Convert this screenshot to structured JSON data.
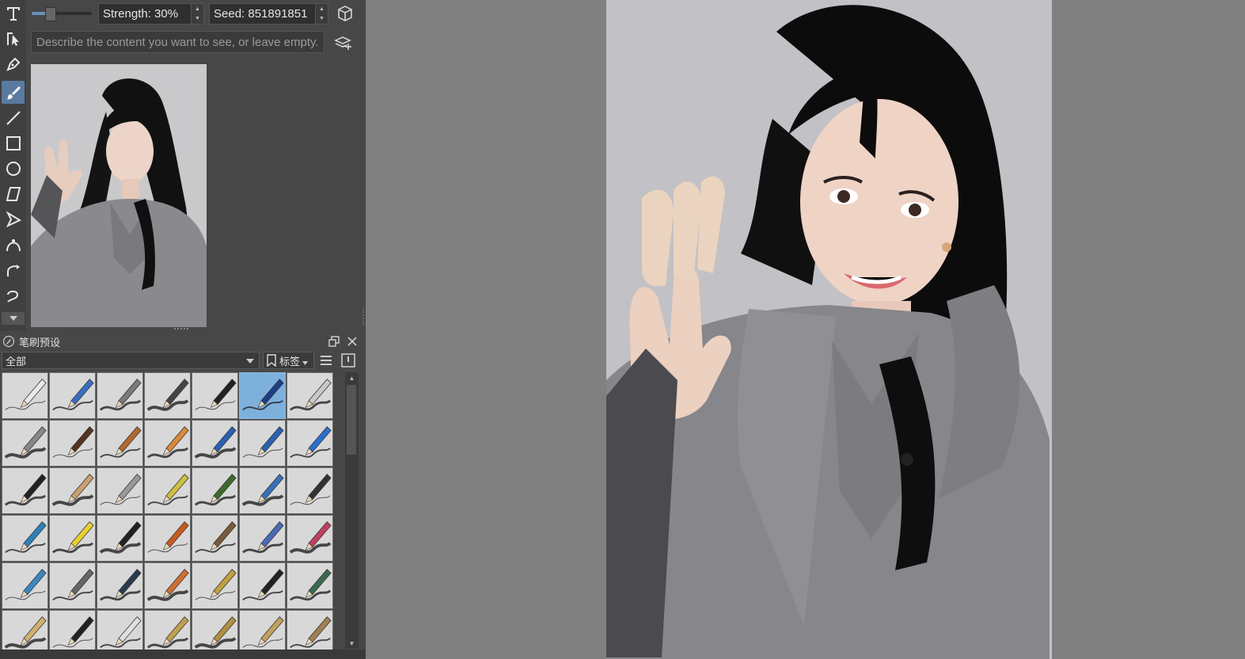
{
  "toolbar": {
    "strength_label": "Strength: 30%",
    "strength_value": 30,
    "seed_label": "Seed: 851891851",
    "prompt_placeholder": "Describe the content you want to see, or leave empty."
  },
  "tools": [
    {
      "name": "text-tool-icon"
    },
    {
      "name": "edit-shapes-tool-icon"
    },
    {
      "name": "calligraphy-tool-icon"
    },
    {
      "name": "freehand-brush-tool-icon",
      "active": true
    },
    {
      "name": "line-tool-icon"
    },
    {
      "name": "rectangle-tool-icon"
    },
    {
      "name": "ellipse-tool-icon"
    },
    {
      "name": "polygon-tool-icon"
    },
    {
      "name": "polyline-tool-icon"
    },
    {
      "name": "bezier-curve-tool-icon"
    },
    {
      "name": "freehand-path-tool-icon"
    },
    {
      "name": "dynamic-brush-tool-icon"
    }
  ],
  "brush_presets": {
    "title": "笔刷预设",
    "filter_value": "全部",
    "tag_label": "标签",
    "selected_index": 5,
    "count": 42
  },
  "colors": {
    "panel": "#474747",
    "canvas_bg": "#808080",
    "accent": "#5a7aa0"
  }
}
